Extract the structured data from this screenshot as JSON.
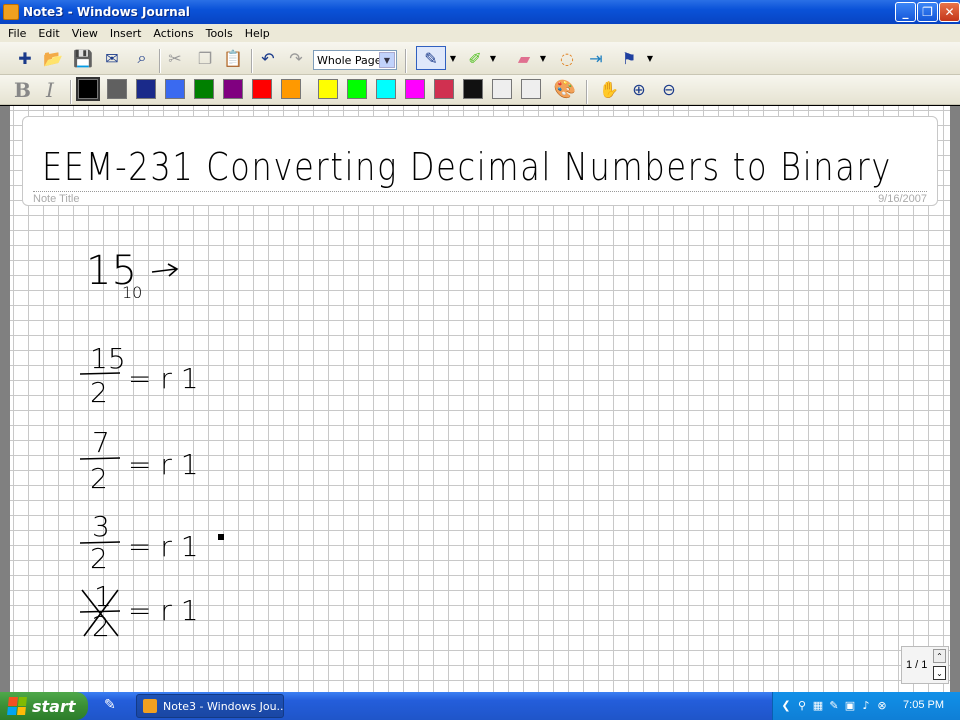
{
  "window": {
    "title": "Note3 - Windows Journal",
    "minimize_glyph": "_",
    "maximize_glyph": "❐",
    "close_glyph": "✕"
  },
  "menu": {
    "items": [
      "File",
      "Edit",
      "View",
      "Insert",
      "Actions",
      "Tools",
      "Help"
    ]
  },
  "toolbar": {
    "zoom_value": "Whole Page",
    "bold_label": "B",
    "italic_label": "I",
    "icons": [
      "new-note-icon",
      "open-icon",
      "save-icon",
      "email-icon",
      "find-icon",
      "cut-icon",
      "copy-icon",
      "paste-icon",
      "undo-icon",
      "redo-icon",
      "pen-icon",
      "highlighter-icon",
      "eraser-icon",
      "lasso-icon",
      "insert-space-icon",
      "flag-icon",
      "hand-icon",
      "zoom-in-icon",
      "zoom-out-icon"
    ],
    "colors": [
      "#000000",
      "#606060",
      "#1a2a8a",
      "#3a6af0",
      "#008000",
      "#800080",
      "#ff0000",
      "#ff9900",
      "#ffff00",
      "#00ff00",
      "#00ffff",
      "#ff00ff",
      "#d03050",
      "#111111",
      "#eeeeee",
      "#eeeeee"
    ]
  },
  "note": {
    "title_handwriting": "EEM-231   Converting Decimal Numbers to Binary",
    "title_label": "Note Title",
    "date": "9/16/2007",
    "ink_lines": [
      {
        "text": "15",
        "subscript": "10",
        "suffix": "→"
      },
      {
        "numerator": "15",
        "denominator": "2",
        "rhs": "= r 1"
      },
      {
        "numerator": "7",
        "denominator": "2",
        "rhs": "= r 1"
      },
      {
        "numerator": "3",
        "denominator": "2",
        "rhs": "= r 1"
      },
      {
        "numerator": "1",
        "denominator": "2",
        "rhs": "= r 1"
      }
    ]
  },
  "page_nav": {
    "count": "1 / 1",
    "up_glyph": "⌃",
    "down_glyph": "⌄"
  },
  "taskbar": {
    "start_label": "start",
    "task_label": "Note3 - Windows Jou...",
    "clock": "7:05 PM"
  }
}
